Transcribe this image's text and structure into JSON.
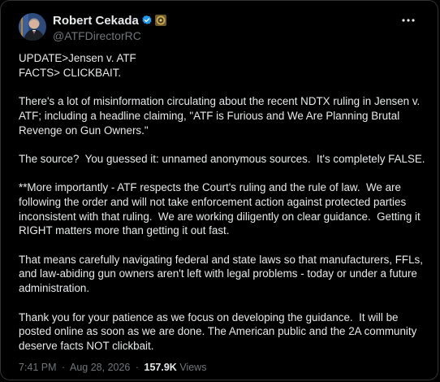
{
  "author": {
    "display_name": "Robert Cekada",
    "handle": "@ATFDirectorRC",
    "avatar_icon": "portrait-avatar",
    "verified_icon": "verified-badge-icon",
    "affiliation_icon": "atf-seal-badge-icon"
  },
  "menu": {
    "more_icon": "more-horizontal-icon"
  },
  "tweet": {
    "paragraphs": [
      "UPDATE>Jensen v. ATF\nFACTS> CLICKBAIT.",
      "There's a lot of misinformation circulating about the recent NDTX ruling in Jensen v. ATF; including a headline claiming, \"ATF is Furious and We Are Planning Brutal Revenge on Gun Owners.\"",
      "The source?  You guessed it: unnamed anonymous sources.  It's completely FALSE.",
      "**More importantly - ATF respects the Court's ruling and the rule of law.  We are following the order and will not take enforcement action against protected parties inconsistent with that ruling.  We are working diligently on clear guidance.  Getting it RIGHT matters more than getting it out fast.",
      "That means carefully navigating federal and state laws so that manufacturers, FFLs, and law-abiding gun owners aren't left with legal problems - today or under a future administration.",
      "Thank you for your patience as we focus on developing the guidance.  It will be posted online as soon as we are done. The American public and the 2A community deserve facts NOT clickbait."
    ]
  },
  "meta": {
    "time": "7:41 PM",
    "date": "Aug 28, 2026",
    "separator": "·",
    "views_count": "157.9K",
    "views_label": "Views"
  },
  "colors": {
    "background": "#000000",
    "text": "#e7e9ea",
    "secondary_text": "#71767b",
    "verified_blue": "#1d9bf0",
    "border": "#2f3336"
  }
}
